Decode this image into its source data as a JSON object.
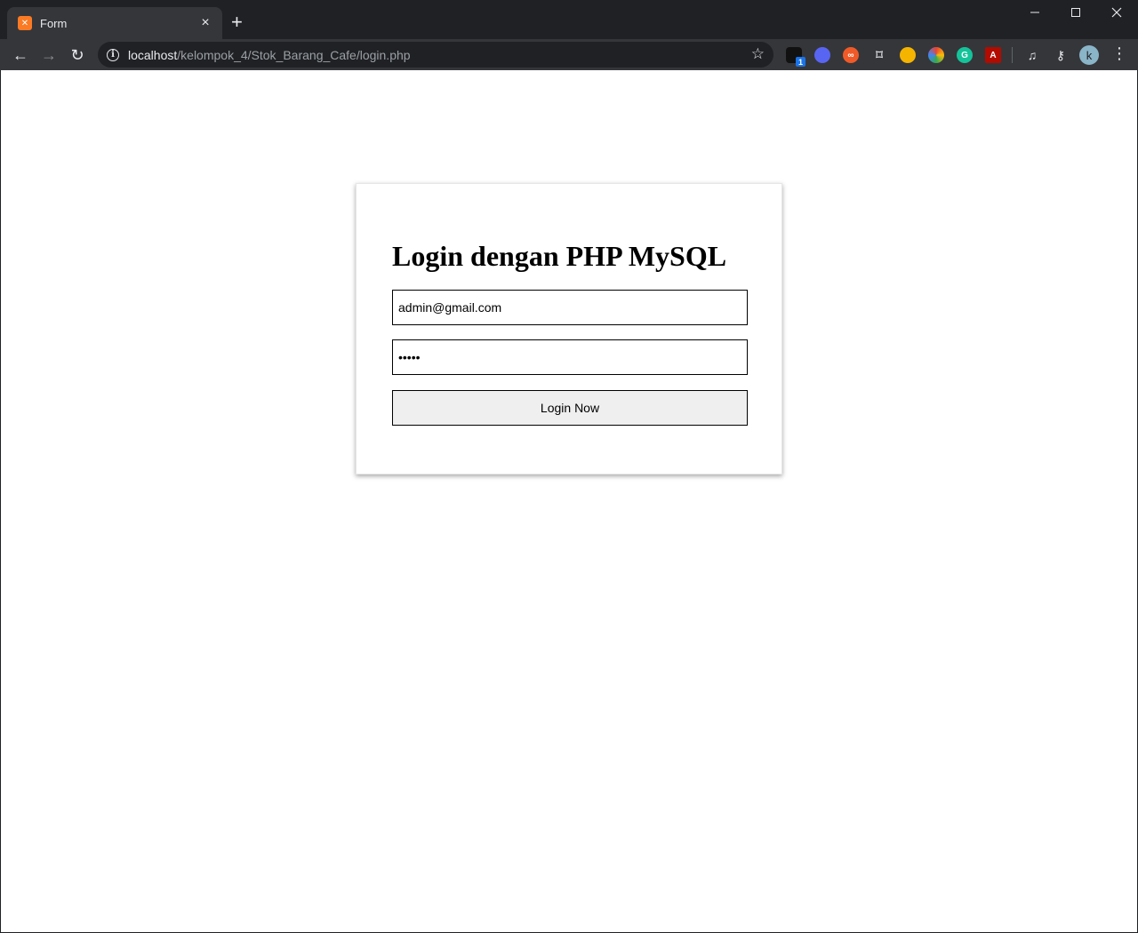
{
  "browser": {
    "tab_title": "Form",
    "tab_favicon": "xampp-favicon",
    "url_host": "localhost",
    "url_path": "/kelompok_4/Stok_Barang_Cafe/login.php",
    "profile_initial": "k",
    "extension_badge": "1",
    "icons": {
      "close": "×",
      "new_tab": "+",
      "minimize": "—",
      "maximize": "☐",
      "window_close": "✕",
      "back": "←",
      "forward": "→",
      "reload": "↻",
      "info": "i",
      "star": "☆",
      "menu": "⋮"
    }
  },
  "login": {
    "heading": "Login dengan PHP MySQL",
    "email_value": "admin@gmail.com",
    "password_value": "•••••",
    "submit_label": "Login Now"
  },
  "colors": {
    "chrome_dark": "#202124",
    "chrome_toolbar": "#35363a",
    "button_bg": "#efefef"
  }
}
